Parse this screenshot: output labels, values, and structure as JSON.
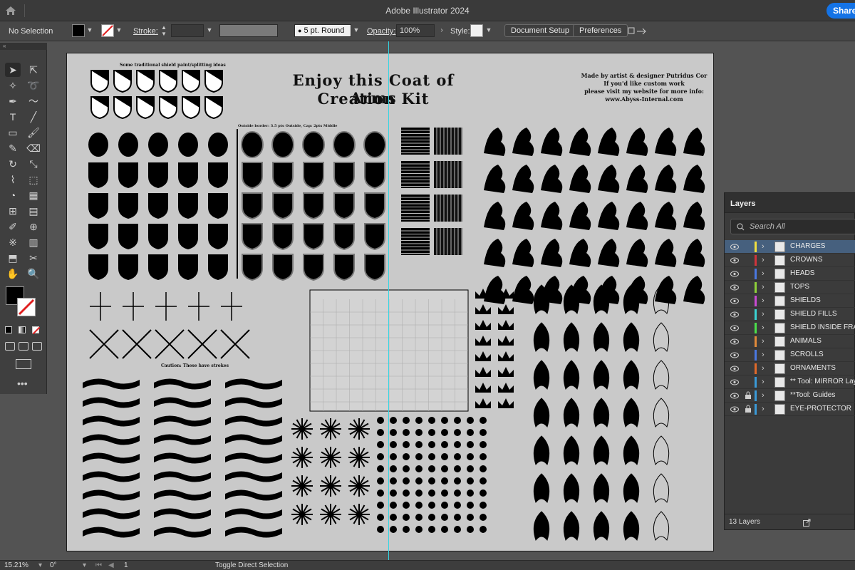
{
  "app": {
    "title": "Adobe Illustrator 2024",
    "share_label": "Share"
  },
  "control_bar": {
    "selection": "No Selection",
    "stroke_label": "Stroke:",
    "brush": "5 pt. Round",
    "opacity_label": "Opacity:",
    "opacity_value": "100%",
    "style_label": "Style:",
    "document_setup": "Document Setup",
    "preferences": "Preferences"
  },
  "artboard_text": {
    "shield_ideas": "Some traditional shield paint/splitting ideas",
    "title_line1": "Enjoy this Coat of Arms",
    "title_line2": "Creation Kit",
    "credit_line1": "Made by artist & designer Putridus Cor",
    "credit_line2": "If you'd like custom work",
    "credit_line3": "please visit my website for more info:",
    "credit_line4": "www.Abyss-Internal.com",
    "border_note": "Outside border: 3.5 pts Outside, Cap: 2pts Middle",
    "caution": "Caution: These have strokes"
  },
  "layers_panel": {
    "tab": "Layers",
    "search_placeholder": "Search All",
    "count": "13 Layers",
    "items": [
      {
        "name": "CHARGES",
        "color": "#f0e040",
        "locked": false,
        "selected": true
      },
      {
        "name": "CROWNS",
        "color": "#d0343c",
        "locked": false,
        "selected": false
      },
      {
        "name": "HEADS",
        "color": "#4a78e0",
        "locked": false,
        "selected": false
      },
      {
        "name": "TOPS",
        "color": "#8ed13a",
        "locked": false,
        "selected": false
      },
      {
        "name": "SHIELDS",
        "color": "#c94bd4",
        "locked": false,
        "selected": false
      },
      {
        "name": "SHIELD FILLS",
        "color": "#3ad3d3",
        "locked": false,
        "selected": false
      },
      {
        "name": "SHIELD INSIDE FRAME",
        "color": "#4be04b",
        "locked": false,
        "selected": false
      },
      {
        "name": "ANIMALS",
        "color": "#e08a3a",
        "locked": false,
        "selected": false
      },
      {
        "name": "SCROLLS",
        "color": "#4a78e0",
        "locked": false,
        "selected": false
      },
      {
        "name": "ORNAMENTS",
        "color": "#e06a2a",
        "locked": false,
        "selected": false
      },
      {
        "name": "** Tool: MIRROR Layer",
        "color": "#3a9ad8",
        "locked": false,
        "selected": false
      },
      {
        "name": "**Tool: Guides",
        "color": "#3a9ad8",
        "locked": true,
        "selected": false
      },
      {
        "name": "EYE-PROTECTOR",
        "color": "#3a9ad8",
        "locked": true,
        "selected": false
      }
    ]
  },
  "status_bar": {
    "zoom": "15.21%",
    "rotation": "0°",
    "artboard_number": "1",
    "tool_hint": "Toggle Direct Selection"
  }
}
